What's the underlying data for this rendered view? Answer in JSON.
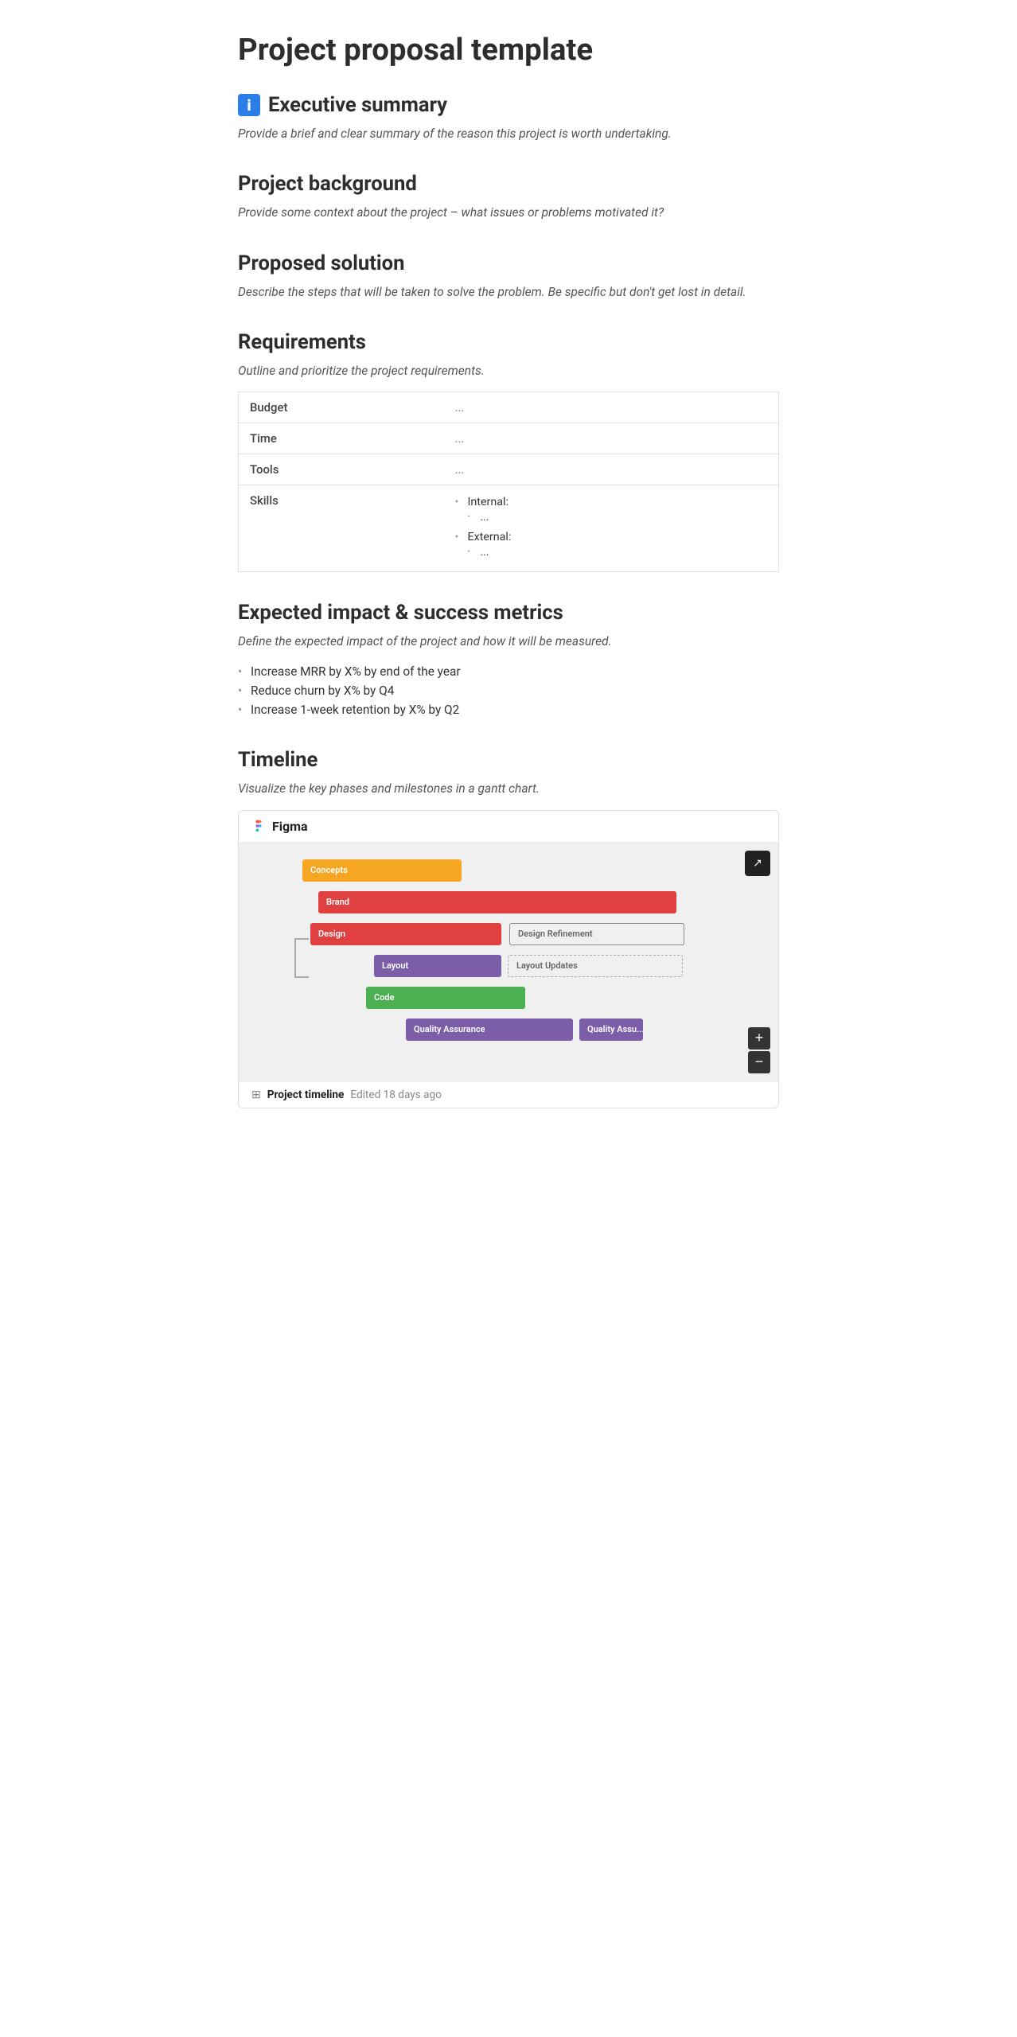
{
  "page": {
    "title": "Project proposal template"
  },
  "sections": {
    "executive_summary": {
      "heading": "Executive summary",
      "has_icon": true,
      "icon_label": "i",
      "description": "Provide a brief and clear summary of the reason this project is worth undertaking."
    },
    "project_background": {
      "heading": "Project background",
      "description": "Provide some context about the project – what issues or problems motivated it?"
    },
    "proposed_solution": {
      "heading": "Proposed solution",
      "description": "Describe the steps that will be taken to solve the problem. Be specific but don't get lost in detail."
    },
    "requirements": {
      "heading": "Requirements",
      "description": "Outline and prioritize the project requirements.",
      "table": {
        "rows": [
          {
            "label": "Budget",
            "value": "..."
          },
          {
            "label": "Time",
            "value": "..."
          },
          {
            "label": "Tools",
            "value": "..."
          },
          {
            "label": "Skills",
            "value": null
          }
        ],
        "skills_internal_label": "Internal:",
        "skills_internal_value": "...",
        "skills_external_label": "External:",
        "skills_external_value": "..."
      }
    },
    "expected_impact": {
      "heading": "Expected impact & success metrics",
      "description": "Define the expected impact of the project and how it will be measured.",
      "bullets": [
        "Increase MRR by X% by end of the year",
        "Reduce churn by X% by Q4",
        "Increase 1-week retention by X% by Q2"
      ]
    },
    "timeline": {
      "heading": "Timeline",
      "description": "Visualize the key phases and milestones in a gantt chart.",
      "figma": {
        "label": "Figma",
        "file_name": "Project timeline",
        "edited": "Edited 18 days ago",
        "gantt": {
          "bars": [
            {
              "id": "concepts",
              "label": "Concepts",
              "class": "concepts"
            },
            {
              "id": "brand",
              "label": "Brand",
              "class": "brand"
            },
            {
              "id": "design",
              "label": "Design",
              "class": "design"
            },
            {
              "id": "design-refinement",
              "label": "Design Refinement",
              "class": "design-refinement"
            },
            {
              "id": "layout",
              "label": "Layout",
              "class": "layout"
            },
            {
              "id": "layout-updates",
              "label": "Layout Updates",
              "class": "layout-updates"
            },
            {
              "id": "code",
              "label": "Code",
              "class": "code"
            },
            {
              "id": "quality-assurance",
              "label": "Quality Assurance",
              "class": "quality-assurance"
            },
            {
              "id": "quality-assurance-2",
              "label": "Quality Assu...",
              "class": "quality-assurance-2"
            }
          ]
        }
      }
    }
  },
  "ui": {
    "expand_button_icon": "↗",
    "zoom_in_label": "+",
    "zoom_out_label": "−"
  }
}
